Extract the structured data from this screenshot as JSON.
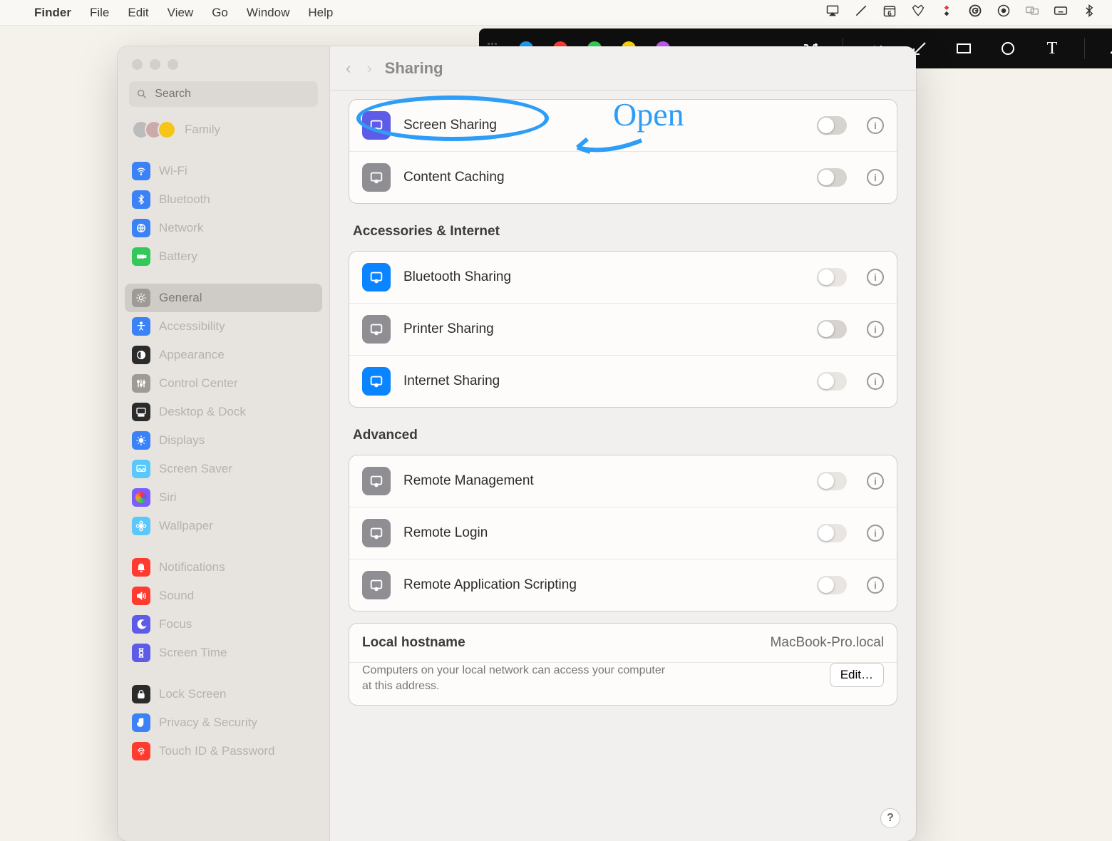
{
  "menubar": {
    "app": "Finder",
    "items": [
      "File",
      "Edit",
      "View",
      "Go",
      "Window",
      "Help"
    ],
    "calendar_day": "6"
  },
  "annotation": {
    "label": "Open"
  },
  "toolbar": {
    "colors": [
      "#1e9df5",
      "#ff3b30",
      "#30d158",
      "#ffd60a",
      "#bf5af2"
    ]
  },
  "window": {
    "title": "Sharing",
    "search_placeholder": "Search"
  },
  "sidebar": {
    "family_label": "Family",
    "items": [
      {
        "label": "Wi-Fi",
        "color": "#3b82f6",
        "icon": "wifi"
      },
      {
        "label": "Bluetooth",
        "color": "#3b82f6",
        "icon": "bluetooth"
      },
      {
        "label": "Network",
        "color": "#3b82f6",
        "icon": "globe"
      },
      {
        "label": "Battery",
        "color": "#34c759",
        "icon": "battery"
      }
    ],
    "items2": [
      {
        "label": "General",
        "color": "#9e9b97",
        "icon": "gear",
        "selected": true
      },
      {
        "label": "Accessibility",
        "color": "#3b82f6",
        "icon": "access"
      },
      {
        "label": "Appearance",
        "color": "#2b2b2b",
        "icon": "appearance"
      },
      {
        "label": "Control Center",
        "color": "#9e9b97",
        "icon": "sliders"
      },
      {
        "label": "Desktop & Dock",
        "color": "#2b2b2b",
        "icon": "dock"
      },
      {
        "label": "Displays",
        "color": "#3b82f6",
        "icon": "sun"
      },
      {
        "label": "Screen Saver",
        "color": "#5ac8fa",
        "icon": "screensaver"
      },
      {
        "label": "Siri",
        "color": "#7a5cff",
        "icon": "siri"
      },
      {
        "label": "Wallpaper",
        "color": "#5ac8fa",
        "icon": "flower"
      }
    ],
    "items3": [
      {
        "label": "Notifications",
        "color": "#ff3b30",
        "icon": "bell"
      },
      {
        "label": "Sound",
        "color": "#ff3b30",
        "icon": "speaker"
      },
      {
        "label": "Focus",
        "color": "#5e5ce6",
        "icon": "moon"
      },
      {
        "label": "Screen Time",
        "color": "#5e5ce6",
        "icon": "hourglass"
      }
    ],
    "items4": [
      {
        "label": "Lock Screen",
        "color": "#2b2b2b",
        "icon": "lock"
      },
      {
        "label": "Privacy & Security",
        "color": "#3b82f6",
        "icon": "hand"
      },
      {
        "label": "Touch ID & Password",
        "color": "#ff3b30",
        "icon": "fingerprint"
      }
    ]
  },
  "content": {
    "group1": [
      {
        "label": "Screen Sharing",
        "icon_color": "#5e5ce6",
        "toggle": "off"
      },
      {
        "label": "Content Caching",
        "icon_color": "#8e8e93",
        "toggle": "off"
      }
    ],
    "section2_title": "Accessories & Internet",
    "group2": [
      {
        "label": "Bluetooth Sharing",
        "icon_color": "#0a84ff",
        "toggle": "light"
      },
      {
        "label": "Printer Sharing",
        "icon_color": "#8e8e93",
        "toggle": "off"
      },
      {
        "label": "Internet Sharing",
        "icon_color": "#0a84ff",
        "toggle": "light"
      }
    ],
    "section3_title": "Advanced",
    "group3": [
      {
        "label": "Remote Management",
        "icon_color": "#8e8e93",
        "toggle": "light"
      },
      {
        "label": "Remote Login",
        "icon_color": "#8e8e93",
        "toggle": "light"
      },
      {
        "label": "Remote Application Scripting",
        "icon_color": "#8e8e93",
        "toggle": "light"
      }
    ],
    "hostname": {
      "label": "Local hostname",
      "value": "MacBook-Pro.local",
      "desc": "Computers on your local network can access your computer at this address.",
      "edit": "Edit…"
    }
  }
}
